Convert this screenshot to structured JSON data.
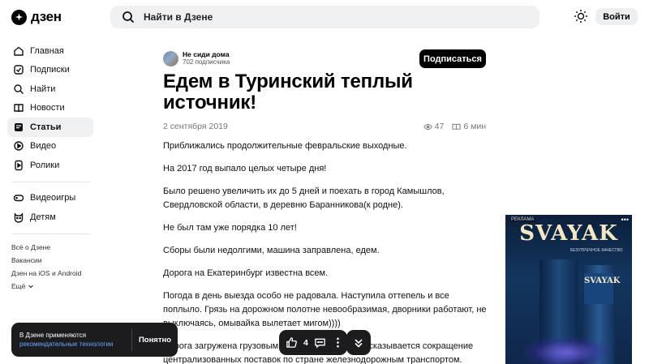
{
  "header": {
    "logo_text": "дзен",
    "search_placeholder": "Найти в Дзене",
    "login_label": "Войти"
  },
  "sidebar": {
    "items": [
      {
        "label": "Главная",
        "icon": "home-icon"
      },
      {
        "label": "Подписки",
        "icon": "subscriptions-icon"
      },
      {
        "label": "Найти",
        "icon": "search-icon"
      },
      {
        "label": "Новости",
        "icon": "news-icon"
      },
      {
        "label": "Статьи",
        "icon": "articles-icon",
        "active": true
      },
      {
        "label": "Видео",
        "icon": "video-icon"
      },
      {
        "label": "Ролики",
        "icon": "shorts-icon"
      }
    ],
    "items2": [
      {
        "label": "Видеоигры",
        "icon": "gamepad-icon"
      },
      {
        "label": "Детям",
        "icon": "kids-icon"
      }
    ],
    "links": [
      "Всё о Дзене",
      "Вакансии",
      "Дзен на iOS и Android",
      "Ещё"
    ]
  },
  "article": {
    "author_name": "Не сиди дома",
    "author_subs": "702 подписчика",
    "subscribe_label": "Подписаться",
    "title": "Едем в Туринский теплый источник!",
    "date": "2 сентября 2019",
    "views": "47",
    "read_time": "6 мин",
    "paragraphs": [
      "Приближались продолжительные февральские выходные.",
      "На 2017 год выпало целых четыре дня!",
      "Было решено увеличить их до 5 дней и поехать в город Камышлов, Свердловской области, в деревню Баранникова(к родне).",
      "Не был там уже порядка 10 лет!",
      "Сборы были недолгими, машина заправлена, едем.",
      "Дорога на Екатеринбург известна всем.",
      "Погода в день выезда особо не радовала. Наступила оттепель и все поплыло. Грязь на дорожном полотне невообразимая, дворники работают, не выключаясь, омывайка вылетает мигом))))",
      "Дорога загружена грузовыми машинами, видимо сказывается сокращение централизованных поставок по стране железнодорожным транспортом."
    ]
  },
  "ad": {
    "label": "РЕКЛАМА",
    "brand": "SVAYAK",
    "subtitle": "БЕЗУПРЕЧНОЕ КАЧЕСТВО",
    "sign": "SVAYAK"
  },
  "cookie": {
    "text": "В Дзене применяются",
    "link": "рекомендательные технологии",
    "button": "Понятно"
  },
  "actions": {
    "likes": "4"
  }
}
